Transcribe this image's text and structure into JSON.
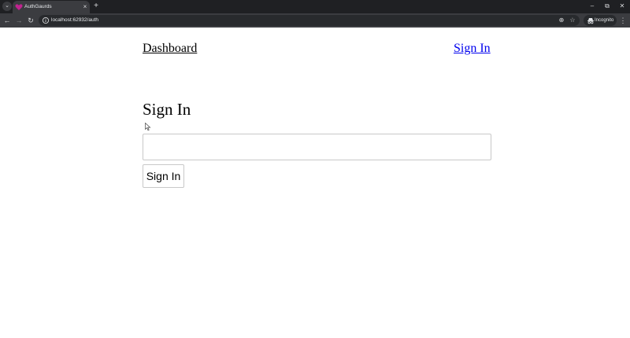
{
  "browser": {
    "tab": {
      "title": "AuthGaurds",
      "favicon": "heart-favicon-icon",
      "close_glyph": "×"
    },
    "tab_search_glyph": "⌄",
    "new_tab_glyph": "+",
    "window_controls": {
      "minimize": "–",
      "restore": "⧉",
      "close": "✕"
    },
    "nav_glyphs": {
      "back": "←",
      "forward": "→",
      "reload": "↻"
    },
    "url": "localhost:62932/auth",
    "zoom_glyph": "⊕",
    "bookmark_glyph": "☆",
    "incognito_label": "Incognito",
    "menu_glyph": "⋮"
  },
  "page": {
    "nav": {
      "dashboard_label": "Dashboard",
      "signin_label": "Sign In"
    },
    "heading": "Sign In",
    "input": {
      "value": "",
      "placeholder": ""
    },
    "submit_label": "Sign In"
  },
  "colors": {
    "tabstrip_bg": "#1f2023",
    "toolbar_bg": "#3b3c40",
    "link_visited": "#000000",
    "link_unvisited": "#0000ee",
    "favicon": "#c0238f"
  }
}
